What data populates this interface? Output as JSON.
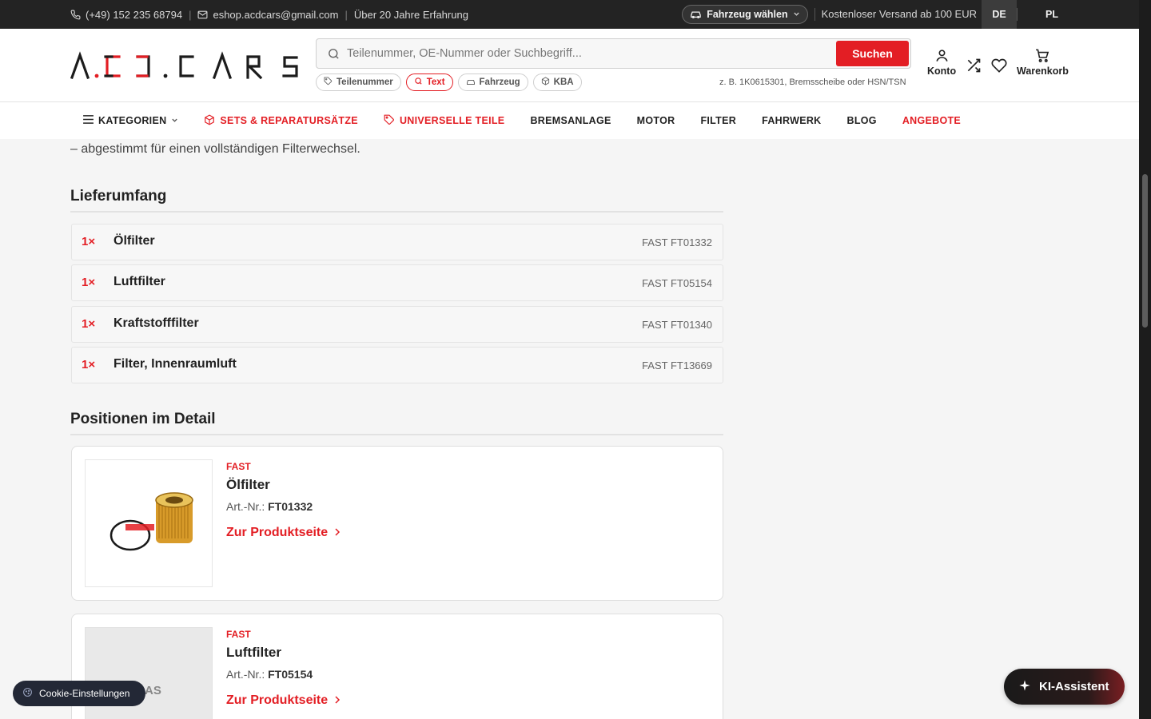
{
  "topbar": {
    "phone": "(+49) 152 235 68794",
    "email": "eshop.acdcars@gmail.com",
    "experience": "Über 20 Jahre Erfahrung",
    "vehicle_button": "Fahrzeug wählen",
    "shipping": "Kostenloser Versand ab 100 EUR",
    "languages": [
      "DE",
      "PL"
    ],
    "active_language": "DE"
  },
  "header": {
    "logo_text": "A.C.D.CARS",
    "search_placeholder": "Teilenummer, OE-Nummer oder Suchbegriff...",
    "search_button": "Suchen",
    "chips": [
      "Teilenummer",
      "Text",
      "Fahrzeug",
      "KBA"
    ],
    "active_chip": "Text",
    "hint": "z. B. 1K0615301, Bremsscheibe oder HSN/TSN",
    "account": "Konto",
    "cart": "Warenkorb"
  },
  "nav": {
    "items": [
      "KATEGORIEN",
      "SETS & REPARATURSÄTZE",
      "UNIVERSELLE TEILE",
      "BREMSANLAGE",
      "MOTOR",
      "FILTER",
      "FAHRWERK",
      "BLOG",
      "ANGEBOTE"
    ]
  },
  "content": {
    "intro": "– abgestimmt für einen vollständigen Filterwechsel.",
    "scope_title": "Lieferumfang",
    "scope": [
      {
        "qty": "1×",
        "name": "Ölfilter",
        "code": "FAST FT01332"
      },
      {
        "qty": "1×",
        "name": "Luftfilter",
        "code": "FAST FT05154"
      },
      {
        "qty": "1×",
        "name": "Kraftstofffilter",
        "code": "FAST FT01340"
      },
      {
        "qty": "1×",
        "name": "Filter, Innenraumluft",
        "code": "FAST FT13669"
      }
    ],
    "detail_title": "Positionen im Detail",
    "cards": [
      {
        "brand": "FAST",
        "name": "Ölfilter",
        "art_label": "Art.-Nr.:",
        "art": "FT01332",
        "link": "Zur Produktseite"
      },
      {
        "brand": "FAST",
        "name": "Luftfilter",
        "art_label": "Art.-Nr.:",
        "art": "FT05154",
        "link": "Zur Produktseite"
      }
    ],
    "thumb2_text": "AS"
  },
  "floating": {
    "cookie": "Cookie-Einstellungen",
    "assistant": "KI-Assistent"
  },
  "colors": {
    "accent": "#e31e24",
    "topbar": "#232323"
  }
}
